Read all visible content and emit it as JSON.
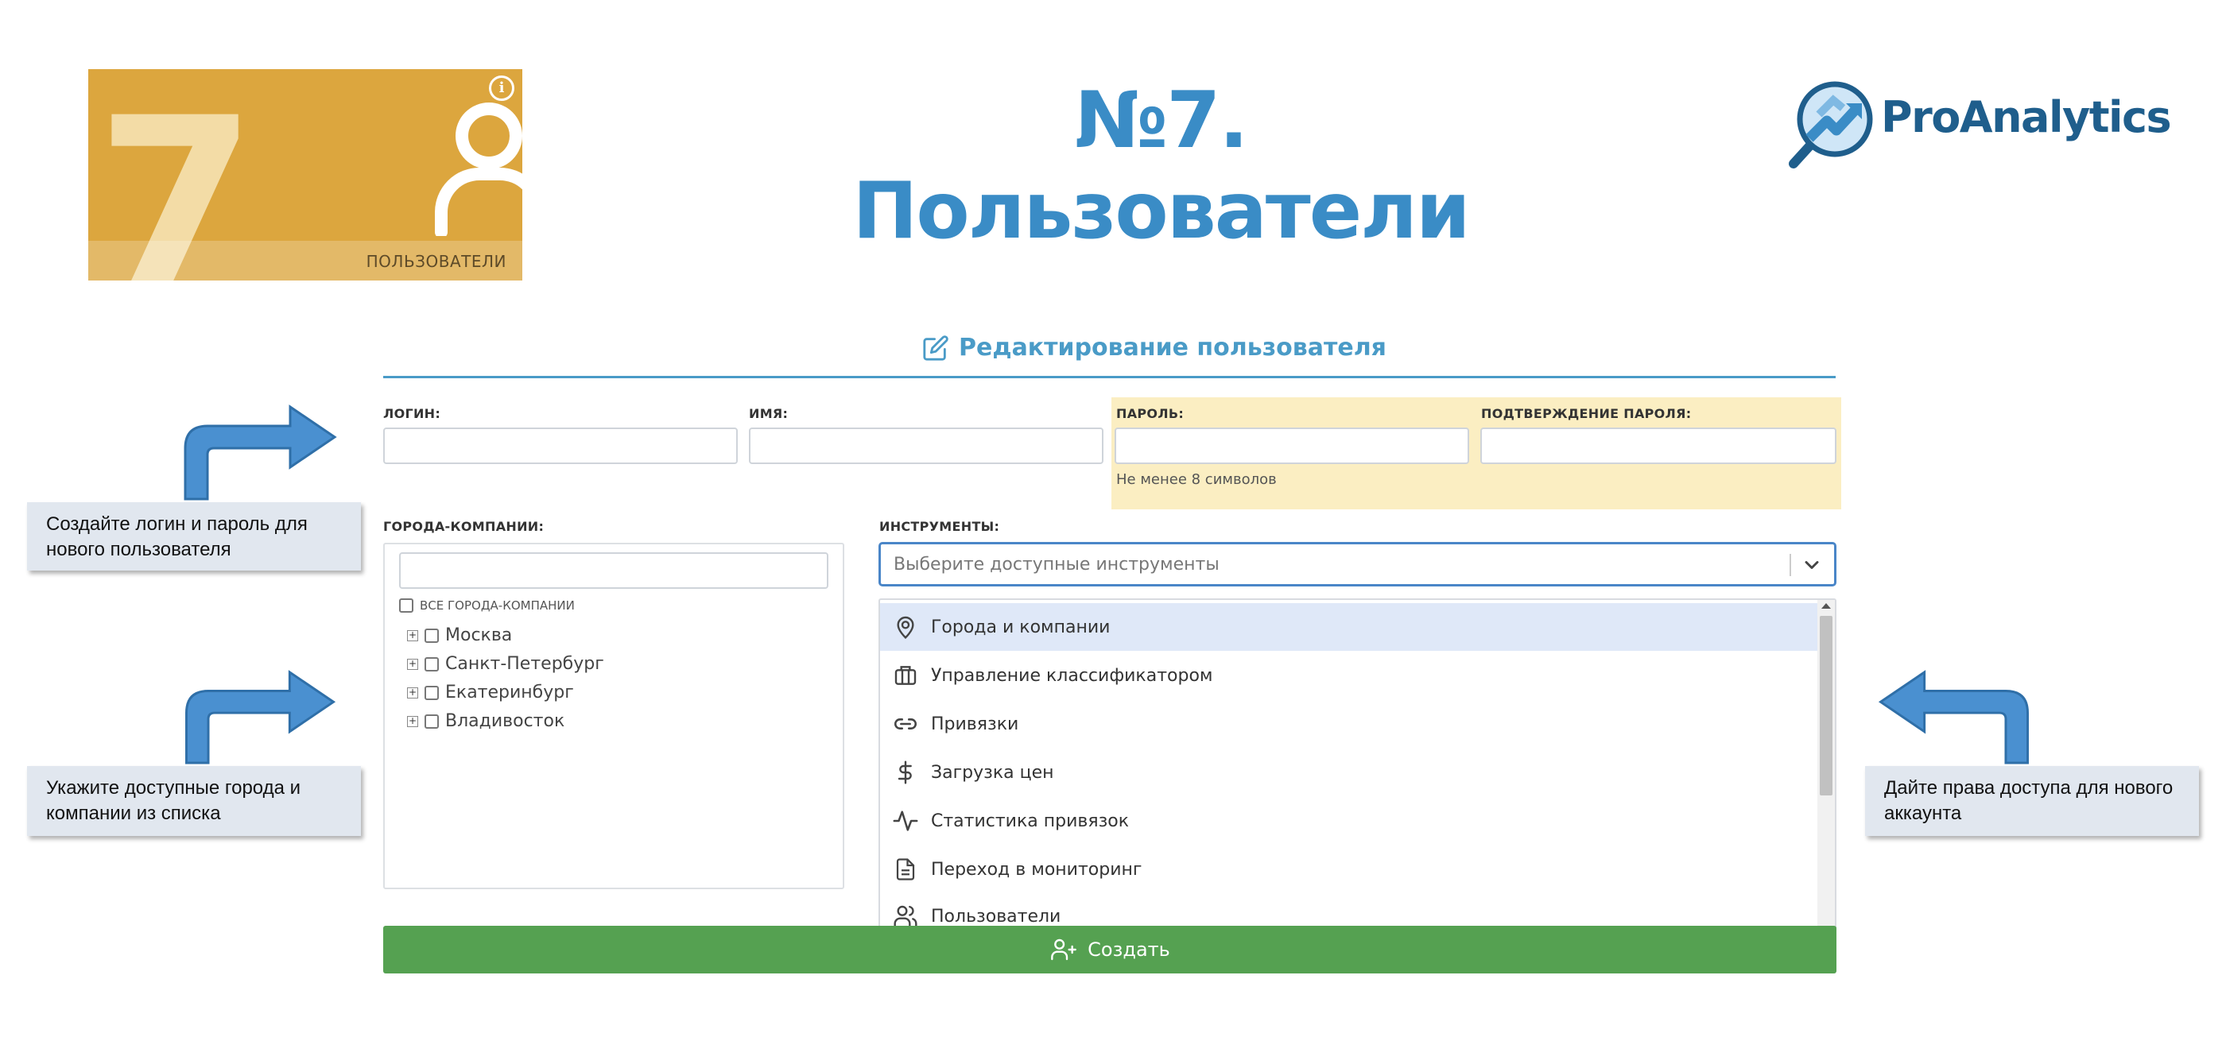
{
  "header": {
    "tile": {
      "number": "7",
      "label": "ПОЛЬЗОВАТЕЛИ",
      "icon": "users-icon",
      "color": "#dca63e"
    },
    "title": "№7. Пользователи",
    "brand": "ProAnalytics",
    "title_color": "#3a8cc6"
  },
  "form": {
    "title": "Редактирование пользователя",
    "title_icon": "edit-icon",
    "fields": {
      "login": {
        "label": "ЛОГИН:",
        "value": ""
      },
      "name": {
        "label": "ИМЯ:",
        "value": ""
      },
      "password": {
        "label": "ПАРОЛЬ:",
        "value": ""
      },
      "password_confirm": {
        "label": "ПОДТВЕРЖДЕНИЕ ПАРОЛЯ:",
        "value": ""
      }
    },
    "password_hint": "Не менее 8 символов",
    "cities": {
      "label": "ГОРОДА-КОМПАНИИ:",
      "search_value": "",
      "all_label": "ВСЕ ГОРОДА-КОМПАНИИ",
      "items": [
        "Москва",
        "Санкт-Петербург",
        "Екатеринбург",
        "Владивосток"
      ]
    },
    "tools": {
      "label": "ИНСТРУМЕНТЫ:",
      "placeholder": "Выберите доступные инструменты",
      "options": [
        {
          "label": "Города и компании",
          "icon": "location-pin-icon",
          "highlighted": true
        },
        {
          "label": "Управление классификатором",
          "icon": "briefcase-icon"
        },
        {
          "label": "Привязки",
          "icon": "link-icon"
        },
        {
          "label": "Загрузка цен",
          "icon": "dollar-icon"
        },
        {
          "label": "Статистика привязок",
          "icon": "activity-icon"
        },
        {
          "label": "Переход в мониторинг",
          "icon": "document-icon"
        },
        {
          "label": "Пользователи",
          "icon": "users-icon"
        }
      ]
    },
    "submit_label": "Создать",
    "accent_color": "#4a9bc7",
    "submit_color": "#55a151",
    "password_zone_color": "#fbeec2"
  },
  "callouts": {
    "login": "Создайте логин и пароль для нового пользователя",
    "cities": "Укажите доступные города и компании из списка",
    "tools": "Дайте права доступа для нового аккаунта"
  }
}
